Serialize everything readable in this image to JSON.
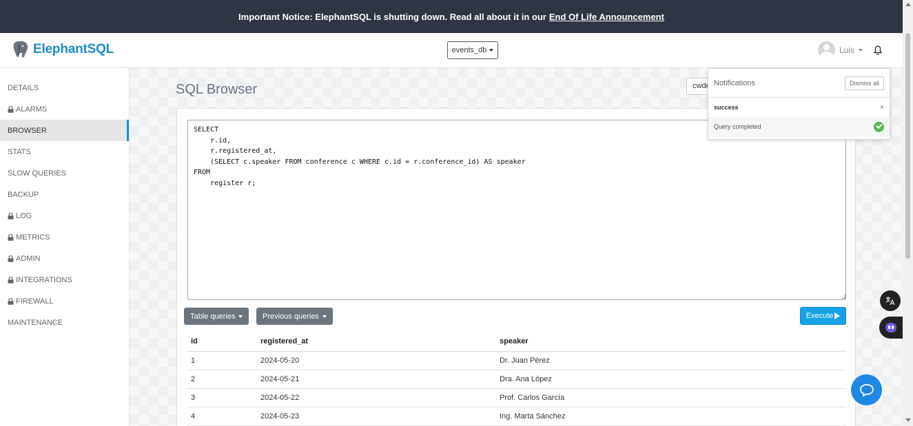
{
  "notice": {
    "text": "Important Notice: ElephantSQL is shutting down. Read all about it in our",
    "link": "End Of Life Announcement"
  },
  "header": {
    "brand": "ElephantSQL",
    "db_select": "events_db",
    "user": "Luis"
  },
  "sidebar": {
    "items": [
      {
        "label": "DETAILS",
        "locked": false,
        "active": false
      },
      {
        "label": "ALARMS",
        "locked": true,
        "active": false
      },
      {
        "label": "BROWSER",
        "locked": false,
        "active": true
      },
      {
        "label": "STATS",
        "locked": false,
        "active": false
      },
      {
        "label": "SLOW QUERIES",
        "locked": false,
        "active": false
      },
      {
        "label": "BACKUP",
        "locked": false,
        "active": false
      },
      {
        "label": "LOG",
        "locked": true,
        "active": false
      },
      {
        "label": "METRICS",
        "locked": true,
        "active": false
      },
      {
        "label": "ADMIN",
        "locked": true,
        "active": false
      },
      {
        "label": "INTEGRATIONS",
        "locked": true,
        "active": false
      },
      {
        "label": "FIREWALL",
        "locked": true,
        "active": false
      },
      {
        "label": "MAINTENANCE",
        "locked": false,
        "active": false
      }
    ]
  },
  "main": {
    "title": "SQL Browser",
    "partial_field": "cwde",
    "query": "SELECT\n    r.id,\n    r.registered_at,\n    (SELECT c.speaker FROM conference c WHERE c.id = r.conference_id) AS speaker\nFROM\n    register r;",
    "table_queries_label": "Table queries",
    "previous_queries_label": "Previous queries",
    "execute_label": "Execute"
  },
  "results": {
    "columns": [
      "id",
      "registered_at",
      "speaker"
    ],
    "rows": [
      [
        "1",
        "2024-05-20",
        "Dr. Juan Pérez"
      ],
      [
        "2",
        "2024-05-21",
        "Dra. Ana López"
      ],
      [
        "3",
        "2024-05-22",
        "Prof. Carlos García"
      ],
      [
        "4",
        "2024-05-23",
        "Ing. Marta Sánchez"
      ]
    ]
  },
  "notifications": {
    "title": "Notifications",
    "dismiss_label": "Dismiss all",
    "type": "success",
    "close": "×",
    "message": "Query completed"
  },
  "widgets": {
    "translate_icon": "translate-icon",
    "bot_icon": "bot-icon",
    "chat_icon": "chat-bubble-icon"
  },
  "colors": {
    "brand": "#1d8cc9",
    "execute": "#17a2e6",
    "notice_bg": "#2f3542",
    "success": "#5cb85c"
  }
}
